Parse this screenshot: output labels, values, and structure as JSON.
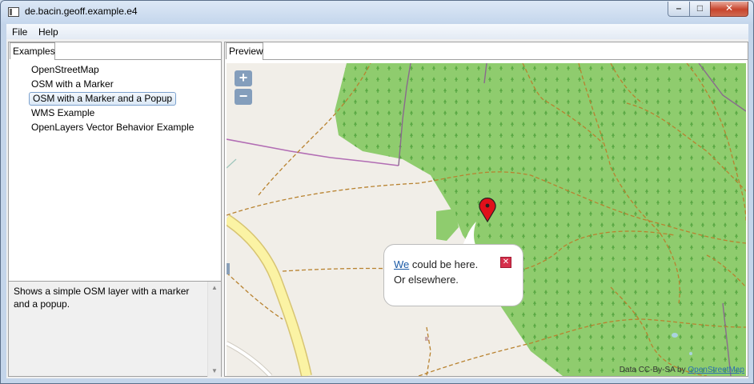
{
  "window": {
    "title": "de.bacin.geoff.example.e4"
  },
  "menu": {
    "file": "File",
    "help": "Help"
  },
  "left_panel": {
    "tab": "Examples",
    "items": [
      {
        "label": "OpenStreetMap",
        "selected": false
      },
      {
        "label": "OSM with a Marker",
        "selected": false
      },
      {
        "label": "OSM with a Marker and a Popup",
        "selected": true
      },
      {
        "label": "WMS Example",
        "selected": false
      },
      {
        "label": "OpenLayers Vector Behavior Example",
        "selected": false
      }
    ],
    "description": "Shows a simple OSM layer with a marker and a popup."
  },
  "preview": {
    "tab": "Preview",
    "zoom_in": "+",
    "zoom_out": "−",
    "popup": {
      "link_word": "We",
      "line1_rest": " could be here.",
      "line2": "Or elsewhere."
    },
    "attribution": {
      "text": "Data CC-By-SA by ",
      "link": "OpenStreetMap"
    },
    "colors": {
      "forest": "#8fcc6e",
      "land": "#f1eee8",
      "road": "#fbf3a4",
      "path": "#b8822f",
      "boundary": "#9b4f9f",
      "marker": "#e0101a"
    }
  }
}
